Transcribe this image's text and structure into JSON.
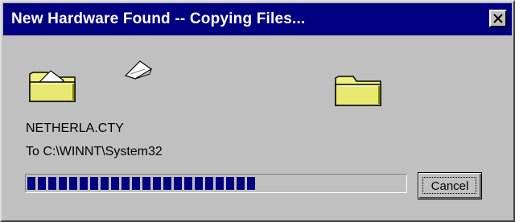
{
  "window": {
    "title": "New Hardware Found -- Copying Files...",
    "close_icon": "close-x-icon"
  },
  "icons": {
    "source_folder": "open-folder-with-paper-icon",
    "flying_paper": "flying-paper-icon",
    "destination_folder": "folder-icon"
  },
  "copy": {
    "file_name": "NETHERLA.CTY",
    "destination": "To C:\\WINNT\\System32"
  },
  "progress": {
    "fraction": 0.62,
    "segment_color": "#000080"
  },
  "buttons": {
    "cancel_label": "Cancel"
  },
  "colors": {
    "titlebar": "#000080",
    "face": "#c0c0c0",
    "folder_yellow": "#f0f080"
  }
}
